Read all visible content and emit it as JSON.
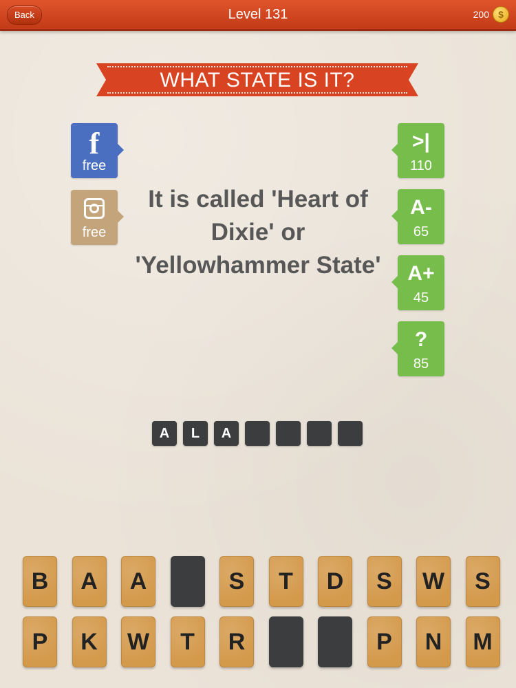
{
  "header": {
    "back_label": "Back",
    "level_title": "Level 131",
    "coins": "200",
    "coin_symbol": "$"
  },
  "banner": {
    "text": "WHAT STATE IS IT?"
  },
  "left_tabs": [
    {
      "icon": "facebook-icon",
      "symbol": "f",
      "label": "free"
    },
    {
      "icon": "instagram-icon",
      "label": "free"
    }
  ],
  "right_tabs": [
    {
      "symbol": ">|",
      "cost": "110"
    },
    {
      "symbol": "A-",
      "cost": "65"
    },
    {
      "symbol": "A+",
      "cost": "45"
    },
    {
      "symbol": "?",
      "cost": "85"
    }
  ],
  "clue": {
    "text": "It is called 'Heart of Dixie' or 'Yellowhammer State'"
  },
  "answer": {
    "slots": [
      "A",
      "L",
      "A",
      "",
      "",
      "",
      ""
    ]
  },
  "keyboard": {
    "row1": [
      "B",
      "A",
      "A",
      "",
      "S",
      "T",
      "D",
      "S",
      "W",
      "S"
    ],
    "row2": [
      "P",
      "K",
      "W",
      "T",
      "R",
      "",
      "",
      "P",
      "N",
      "M"
    ]
  },
  "colors": {
    "header_red": "#d84421",
    "facebook_blue": "#4a6fc1",
    "instagram_tan": "#c4a47a",
    "hint_green": "#77bd4c",
    "tile_orange": "#d49a4c",
    "slot_dark": "#3b3d3f"
  }
}
